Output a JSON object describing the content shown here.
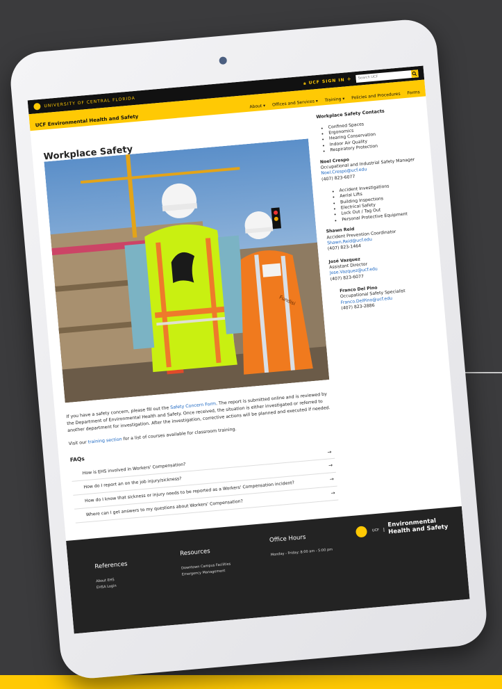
{
  "colors": {
    "ucf_gold": "#ffc904",
    "ucf_black": "#111111",
    "link": "#1a66c2",
    "footer": "#232323"
  },
  "header": {
    "university": "UNIVERSITY OF CENTRAL FLORIDA",
    "sign_in": "UCF SIGN IN",
    "search_placeholder": "Search UCF",
    "site_title": "UCF Environmental Health and Safety",
    "nav": [
      "About",
      "Offices and Services",
      "Training",
      "Policies and Procedures",
      "Forms"
    ]
  },
  "page": {
    "title": "Workplace Safety",
    "paragraph1_before": "If you have a safety concern, please fill out the ",
    "paragraph1_link": "Safety Concern Form",
    "paragraph1_after": ". The report is submitted online and is reviewed by the Department of Environmental Health and Safety. Once received, the situation is either investigated or referred to another department for investigation. After the investigation, corrective actions will be planned and executed if needed.",
    "paragraph2_before": "Visit our ",
    "paragraph2_link": "training section",
    "paragraph2_after": " for a list of courses available for classroom training."
  },
  "sidebar": {
    "heading": "Workplace Safety Contacts",
    "topics1": [
      "Confined Spaces",
      "Ergonomics",
      "Hearing Conservation",
      "Indoor Air Quality",
      "Respiratory Protection"
    ],
    "contact1": {
      "name": "Noel Crespo",
      "role": "Occupational and Industrial Safety Manager",
      "email": "Noel.Crespo@ucf.edu",
      "phone": "(407) 823-6077"
    },
    "topics2": [
      "Accident Investigations",
      "Aerial Lifts",
      "Building Inspections",
      "Electrical Safety",
      "Lock Out / Tag Out",
      "Personal Protective Equipment"
    ],
    "contact2": {
      "name": "Shawn Reid",
      "role": "Accident Prevention Coordinator",
      "email": "Shawn.Reid@ucf.edu",
      "phone": "(407) 823-1464"
    },
    "contact3": {
      "name": "José Vazquez",
      "role": "Assistant Director",
      "email": "Jose.Vazquez@ucf.edu",
      "phone": "(407) 823-6077"
    },
    "contact4": {
      "name": "Franco Del Pino",
      "role": "Occupational Safety Specialist",
      "email": "Franco.DelPino@ucf.edu",
      "phone": "(407) 823-2886"
    }
  },
  "faqs": {
    "title": "FAQs",
    "items": [
      "How is EHS involved in Workers' Compensation?",
      "How do I report an on the job injury/sickness?",
      "How do I know that sickness or injury needs to be reported as a Workers' Compensation incident?",
      "Where can I get answers to my questions about Workers' Compensation?"
    ]
  },
  "footer": {
    "references": {
      "heading": "References",
      "links": [
        "About EHS",
        "EHSA Login"
      ]
    },
    "resources": {
      "heading": "Resources",
      "links": [
        "Downtown Campus Facilities",
        "Emergency Management"
      ]
    },
    "hours": {
      "heading": "Office Hours",
      "text": "Monday - Friday: 8:00 am - 5:00 pm"
    },
    "brand": {
      "ucf": "UCF",
      "line1": "Environmental",
      "line2": "Health and Safety"
    }
  },
  "hero_image": {
    "vest_text": "Fundisi"
  }
}
